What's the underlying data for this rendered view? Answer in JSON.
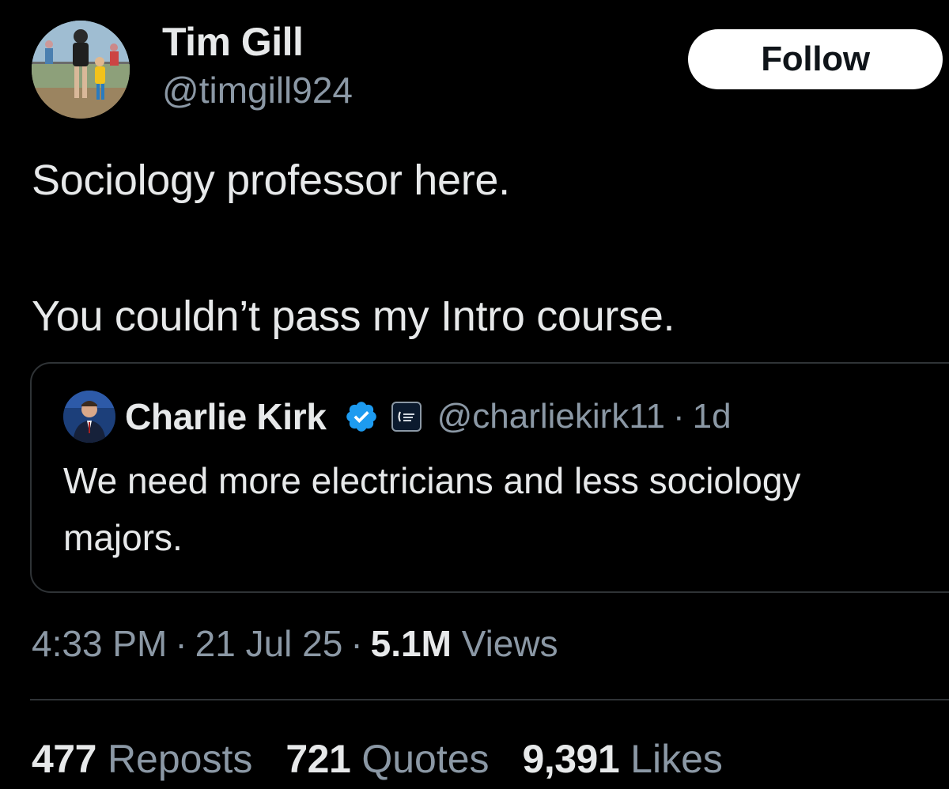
{
  "author": {
    "name": "Tim Gill",
    "handle": "@timgill924",
    "avatar_icon": "profile-photo-icon"
  },
  "follow_label": "Follow",
  "tweet_lines": [
    "Sociology professor here.",
    "You couldn’t pass my Intro course."
  ],
  "quote": {
    "name": "Charlie Kirk",
    "verified_icon": "verified-badge-icon",
    "org_icon": "organization-badge-icon",
    "handle": "@charliekirk11",
    "dot": "·",
    "time": "1d",
    "text": "We need more electricians and less sociology majors."
  },
  "meta": {
    "time": "4:33 PM",
    "date": "21 Jul 25",
    "views_count": "5.1M",
    "views_label": "Views",
    "sep": "·"
  },
  "stats": {
    "reposts_count": "477",
    "reposts_label": "Reposts",
    "quotes_count": "721",
    "quotes_label": "Quotes",
    "likes_count": "9,391",
    "likes_label": "Likes"
  },
  "colors": {
    "background": "#000000",
    "primary_text": "#e7e9ea",
    "secondary_text": "#8b98a5",
    "border": "#2f3336",
    "verified": "#1d9bf0"
  }
}
